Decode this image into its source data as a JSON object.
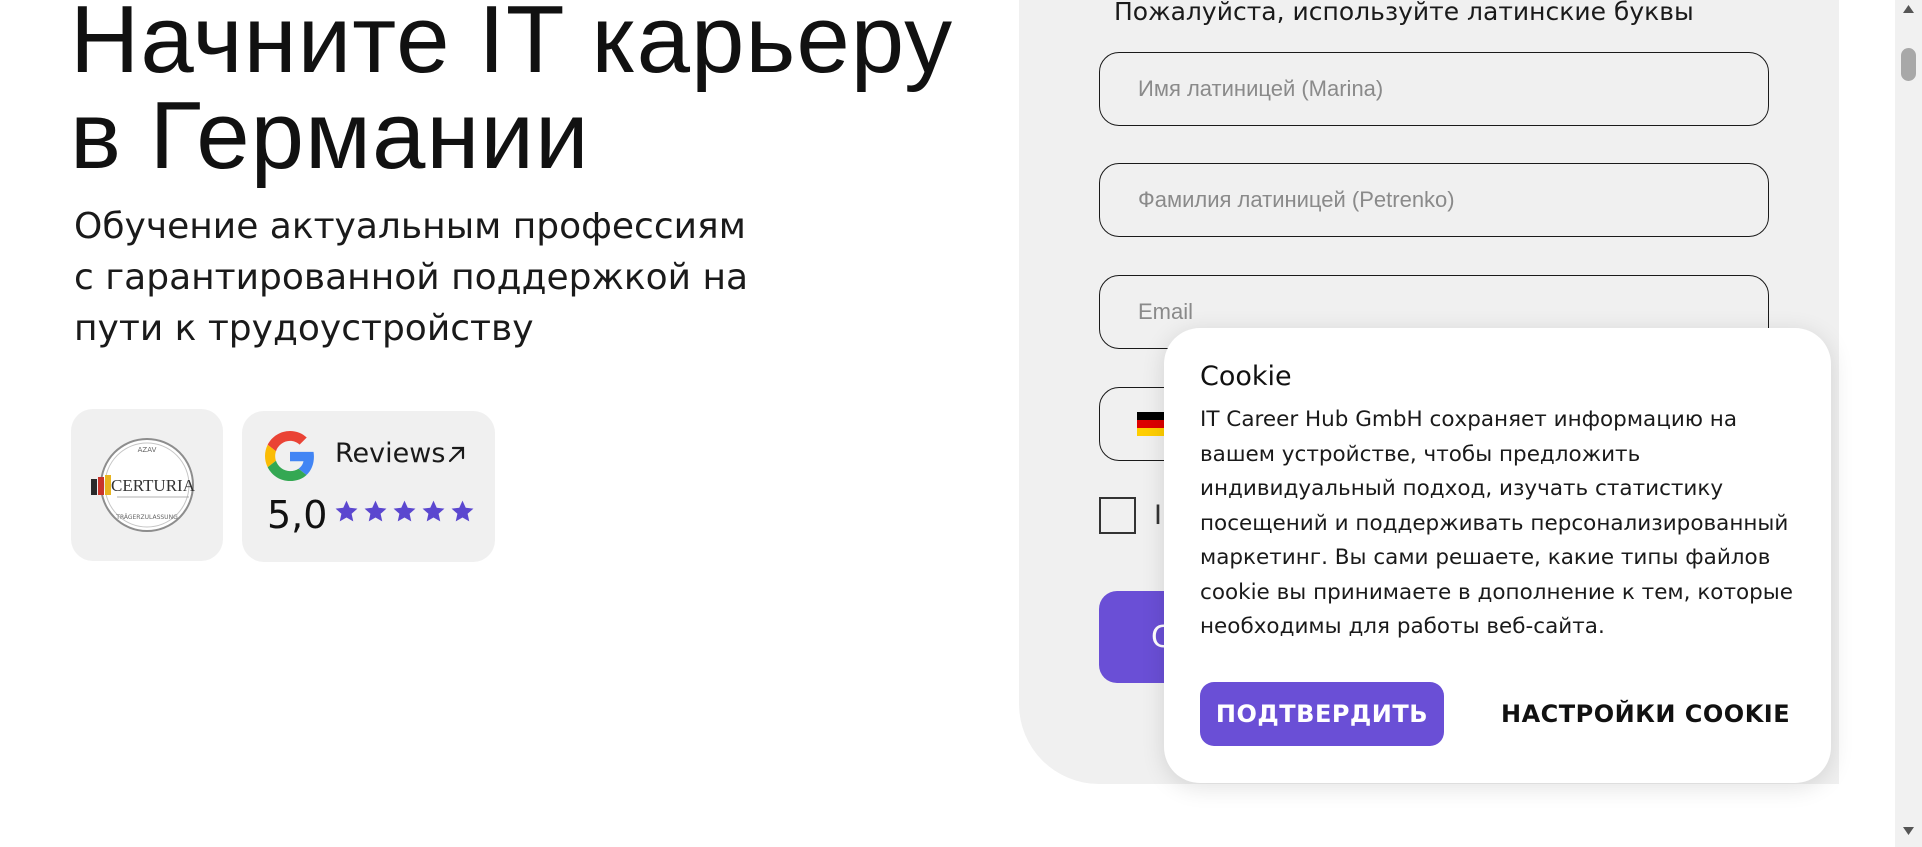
{
  "hero": {
    "title_line1": "Начните IT карьеру",
    "title_line2": "в Германии",
    "subtitle": "Обучение актуальным профессиям с гарантированной поддержкой на пути к трудоустройству"
  },
  "badges": {
    "certuria": {
      "logo_text": "CERTURIA",
      "logo_top": "AZAV",
      "logo_bottom": "TRÄGERZULASSUNG"
    },
    "reviews": {
      "label": "Reviews",
      "rating": "5,0",
      "stars": 5
    }
  },
  "form": {
    "hint": "Пожалуйста, используйте латинские буквы",
    "first_name_placeholder": "Имя латиницей (Marina)",
    "last_name_placeholder": "Фамилия латиницей (Petrenko)",
    "email_placeholder": "Email",
    "checkbox_label_partial": "I",
    "submit_label_partial": "С"
  },
  "cookie": {
    "title": "Cookie",
    "text": "IT Career Hub GmbH сохраняет информацию на вашем устройстве, чтобы предложить индивидуальный подход, изучать статистику посещений и поддерживать персонализированный маркетинг. Вы сами решаете, какие типы файлов cookie вы принимаете в дополнение к тем, которые необходимы для работы веб-сайта.",
    "confirm_label": "ПОДТВЕРДИТЬ",
    "settings_label": "НАСТРОЙКИ COOKIE"
  },
  "colors": {
    "accent": "#6a4fd6",
    "panel": "#f0f0f0",
    "star": "#5b47cf"
  }
}
